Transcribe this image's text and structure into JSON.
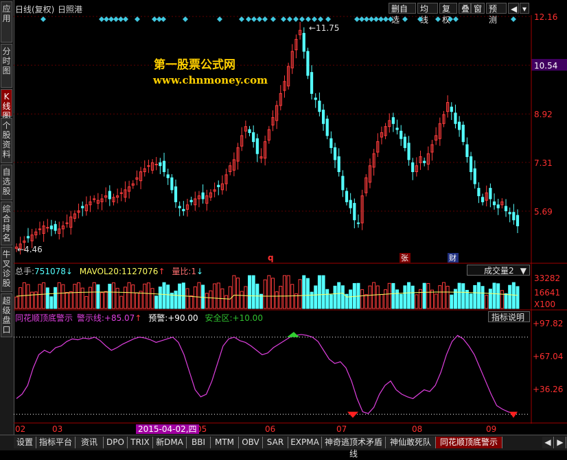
{
  "sidebar": {
    "tabs": [
      {
        "label": "应用",
        "active": false
      },
      {
        "label": "分时图",
        "active": false
      },
      {
        "label": "K线图",
        "active": true
      },
      {
        "label": "个股资料",
        "active": false
      },
      {
        "label": "自选股",
        "active": false
      },
      {
        "label": "综合排名",
        "active": false
      },
      {
        "label": "牛叉诊股",
        "active": false
      },
      {
        "label": "超级盘口",
        "active": false
      }
    ]
  },
  "header": {
    "title": "日线(复权)",
    "stock": "日照港",
    "buttons": [
      "删自选",
      "均线",
      "复权",
      "叠",
      "窗",
      "预测"
    ]
  },
  "watermark": {
    "line1": "第一股票公式网",
    "line2": "www.chnmoney.com"
  },
  "price_axis": {
    "labels": [
      "12.16",
      "10.54",
      "8.92",
      "7.31",
      "5.69"
    ],
    "highlight": "10.54"
  },
  "annotations": {
    "high": "11.75",
    "low": "4.46",
    "markers": [
      "q",
      "张",
      "财"
    ]
  },
  "volume": {
    "label": "总手:",
    "total": "751078",
    "ma_label": "MAVOL20:",
    "ma_value": "1127076",
    "ratio_label": "量比:",
    "ratio_value": "1",
    "selector": "成交量2",
    "axis": [
      "33282",
      "16641",
      "X100"
    ]
  },
  "indicator": {
    "name": "同花顺顶底警示",
    "warn_label": "警示线:",
    "warn_value": "+85.07",
    "pre_label": "预警:",
    "pre_value": "+90.00",
    "safe_label": "安全区:",
    "safe_value": "+10.00",
    "help": "指标说明",
    "axis": [
      "+97.82",
      "+67.04",
      "+36.26"
    ]
  },
  "time_axis": {
    "labels": [
      "02",
      "03",
      "05",
      "06",
      "07",
      "08",
      "09"
    ],
    "cursor_date": "2015-04-02,四"
  },
  "bottom_tabs": [
    "设置",
    "指标平台",
    "资讯",
    "DPO",
    "TRIX",
    "新DMA",
    "BBI",
    "MTM",
    "OBV",
    "SAR",
    "EXPMA",
    "神奇逃顶术矛盾线",
    "神仙敢死队",
    "同花顺顶底警示"
  ],
  "colors": {
    "up": "#ff3c3c",
    "down": "#54ffff",
    "ma": "#ffff60",
    "osc": "#e040e0"
  },
  "chart_data": {
    "type": "candlestick",
    "price_range": [
      4.46,
      12.16
    ],
    "close": [
      4.5,
      4.6,
      4.7,
      4.8,
      4.9,
      5.0,
      5.1,
      5.2,
      5.15,
      5.1,
      5.05,
      5.1,
      5.2,
      5.3,
      5.5,
      5.6,
      5.7,
      5.8,
      5.9,
      6.0,
      6.1,
      6.05,
      6.1,
      6.2,
      6.1,
      6.15,
      6.2,
      6.3,
      6.4,
      6.5,
      6.6,
      6.8,
      7.0,
      7.1,
      7.2,
      7.3,
      7.25,
      7.2,
      7.0,
      6.8,
      6.4,
      6.0,
      5.8,
      5.7,
      5.9,
      6.0,
      6.1,
      6.2,
      6.1,
      6.2,
      6.3,
      6.4,
      6.5,
      6.6,
      6.9,
      7.2,
      7.4,
      7.8,
      8.2,
      8.5,
      8.3,
      8.0,
      7.6,
      7.5,
      8.0,
      8.4,
      8.8,
      9.2,
      9.6,
      10.0,
      10.5,
      11.0,
      11.4,
      11.7,
      11.0,
      10.2,
      9.6,
      9.4,
      9.0,
      8.6,
      8.2,
      7.8,
      7.4,
      7.0,
      6.4,
      6.0,
      5.8,
      5.4,
      5.3,
      6.2,
      6.8,
      7.2,
      7.6,
      8.0,
      8.3,
      8.5,
      8.7,
      8.6,
      8.4,
      8.1,
      7.8,
      7.4,
      7.0,
      7.2,
      7.5,
      7.3,
      7.6,
      7.9,
      8.2,
      8.6,
      8.9,
      9.3,
      9.0,
      8.6,
      8.4,
      8.0,
      7.5,
      7.0,
      6.6,
      6.2,
      6.0,
      6.3,
      6.1,
      5.9,
      5.8,
      6.0,
      5.7,
      5.6,
      5.4,
      5.2
    ],
    "volume_axis": [
      "33282",
      "16641"
    ],
    "oscillator_range": [
      0,
      100
    ]
  }
}
